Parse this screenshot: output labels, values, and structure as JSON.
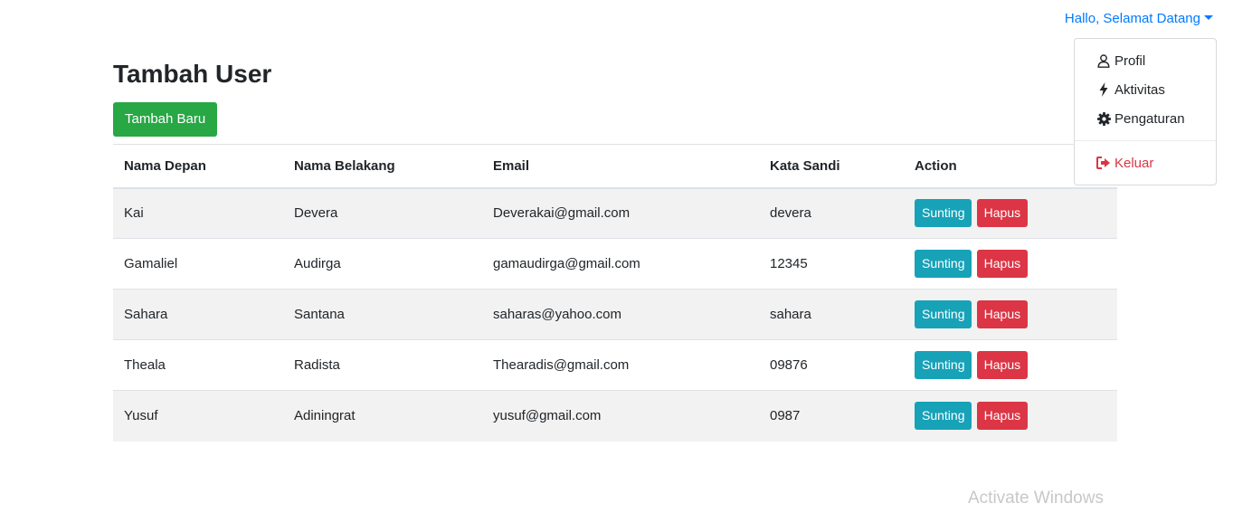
{
  "header": {
    "user_greeting": "Hallo, Selamat Datang"
  },
  "dropdown": {
    "items": [
      {
        "label": "Profil",
        "icon": "user-icon"
      },
      {
        "label": "Aktivitas",
        "icon": "bolt-icon"
      },
      {
        "label": "Pengaturan",
        "icon": "gear-icon"
      }
    ],
    "logout": {
      "label": "Keluar",
      "icon": "sign-out-icon"
    }
  },
  "main": {
    "title": "Tambah User",
    "add_button": "Tambah Baru"
  },
  "table": {
    "columns": [
      "Nama Depan",
      "Nama Belakang",
      "Email",
      "Kata Sandi",
      "Action"
    ],
    "rows": [
      {
        "first": "Kai",
        "last": "Devera",
        "email": "Deverakai@gmail.com",
        "password": "devera"
      },
      {
        "first": "Gamaliel",
        "last": "Audirga",
        "email": "gamaudirga@gmail.com",
        "password": "12345"
      },
      {
        "first": "Sahara",
        "last": "Santana",
        "email": "saharas@yahoo.com",
        "password": "sahara"
      },
      {
        "first": "Theala",
        "last": "Radista",
        "email": "Thearadis@gmail.com",
        "password": "09876"
      },
      {
        "first": "Yusuf",
        "last": "Adiningrat",
        "email": "yusuf@gmail.com",
        "password": "0987"
      }
    ],
    "edit_label": "Sunting",
    "delete_label": "Hapus"
  },
  "watermark": "Activate Windows",
  "colors": {
    "primary": "#007bff",
    "success": "#28a745",
    "info": "#17a2b8",
    "danger": "#dc3545"
  }
}
